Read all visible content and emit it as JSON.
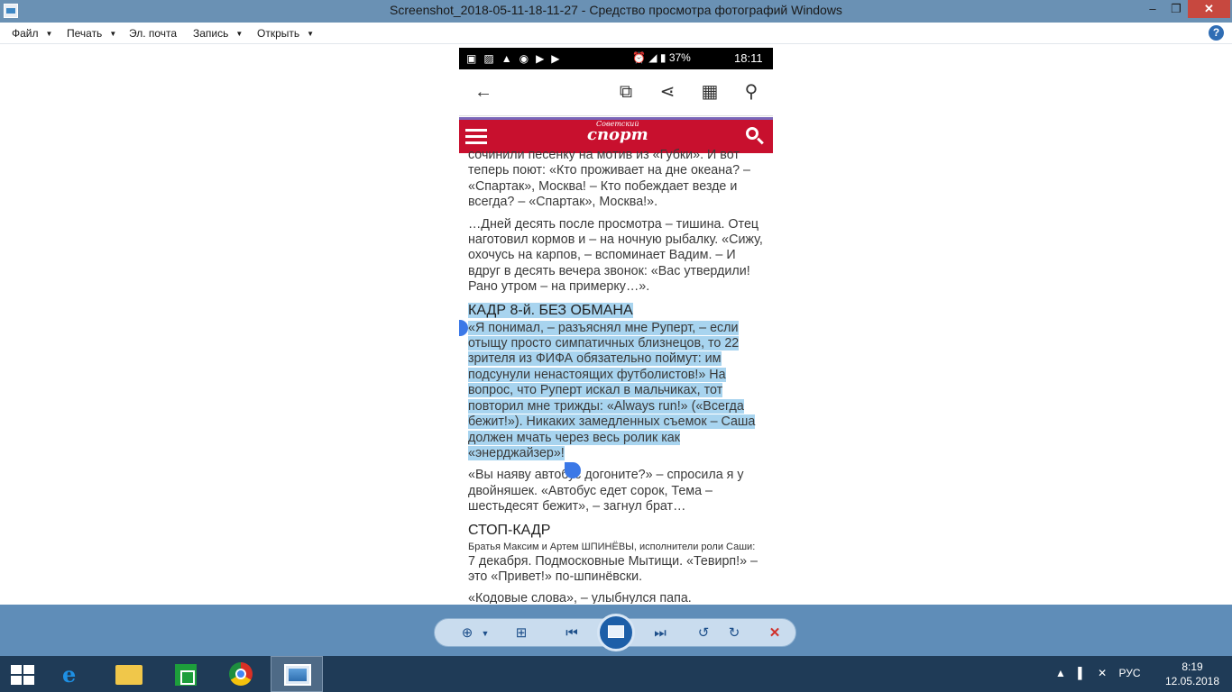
{
  "window": {
    "title": "Screenshot_2018-05-11-18-11-27 - Средство просмотра фотографий Windows",
    "minimize": "‒",
    "maximize": "❐",
    "close": "✕"
  },
  "menu": {
    "items": [
      {
        "label": "Файл",
        "has_dropdown": true
      },
      {
        "label": "Печать",
        "has_dropdown": true
      },
      {
        "label": "Эл. почта",
        "has_dropdown": false
      },
      {
        "label": "Запись",
        "has_dropdown": true
      },
      {
        "label": "Открыть",
        "has_dropdown": true
      }
    ],
    "dropdown_glyph": "▼",
    "help": "?"
  },
  "phone": {
    "status": {
      "battery": "37%",
      "time": "18:11"
    },
    "site": {
      "logo_small": "Советский",
      "logo": "спорт"
    },
    "article": {
      "p1": "сочинили песенку на мотив из «Губки». И вот теперь поют: «Кто проживает на дне океана? – «Спартак», Москва! – Кто побеждает везде и всегда? – «Спартак», Москва!».",
      "p2": "…Дней десять после просмотра – тишина. Отец наготовил кормов и – на ночную рыбалку. «Сижу, охочусь на карпов, – вспоминает Вадим. – И вдруг в десять вечера звонок: «Вас утвердили! Рано утром – на примерку…».",
      "h1": "КАДР 8-й. БЕЗ ОБМАНА",
      "p3": "«Я понимал, – разъяснял мне Руперт, – если отыщу просто симпатичных близнецов, то 22 зрителя из ФИФА обязательно поймут: им подсунули ненастоящих футболистов!» На вопрос, что Руперт искал в мальчиках, тот повторил мне трижды: «Always run!» («Всегда бежит!»). Никаких замедленных съемок – Саша должен мчать через весь ролик как «энерджайзер»!",
      "p4": "«Вы наяву автобус догоните?» – спросила я у двойняшек. «Автобус едет сорок, Тема – шестьдесят бежит», – загнул брат…",
      "h2": "СТОП-КАДР",
      "caption": "Братья Максим и Артем ШПИНЁВЫ, исполнители роли Саши:",
      "p5": "7 декабря. Подмосковные Мытищи. «Тевирп!» – это «Привет!» по-шпинёвски.",
      "p6": "«Кодовые слова», – улыбнулся папа."
    }
  },
  "taskbar": {
    "tray_lang": "РУС",
    "clock_time": "8:19",
    "clock_date": "12.05.2018"
  }
}
